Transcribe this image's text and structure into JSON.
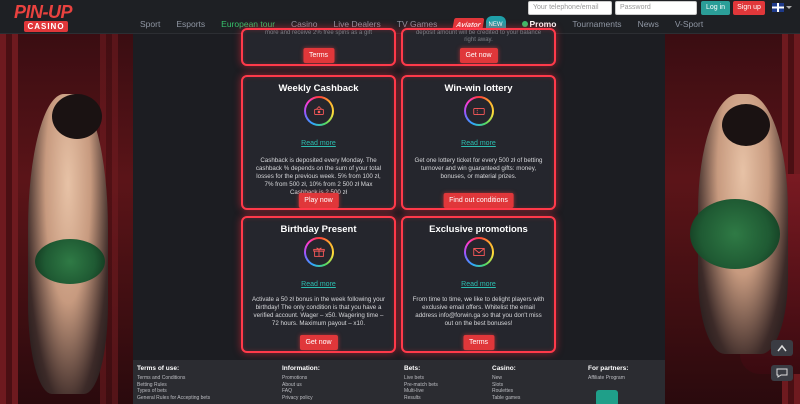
{
  "header": {
    "logo_top": "PIN-UP",
    "logo_bottom": "CASINO",
    "nav": [
      {
        "label": "Sport",
        "style": "normal"
      },
      {
        "label": "Esports",
        "style": "normal"
      },
      {
        "label": "European tour",
        "style": "active"
      },
      {
        "label": "Casino",
        "style": "normal"
      },
      {
        "label": "Live Dealers",
        "style": "normal"
      },
      {
        "label": "TV Games",
        "style": "normal"
      },
      {
        "label": "Aviator",
        "badge": "NEW",
        "style": "badge"
      },
      {
        "label": "Promo",
        "style": "highlight"
      },
      {
        "label": "Tournaments",
        "style": "normal"
      },
      {
        "label": "News",
        "style": "normal"
      },
      {
        "label": "V-Sport",
        "style": "normal"
      }
    ],
    "phone_placeholder": "Your telephone/email",
    "password_placeholder": "Password",
    "login_label": "Log in",
    "signup_label": "Sign up",
    "language_icon": "uk-flag-icon"
  },
  "cards": {
    "top_left": {
      "partial_text": "more and receive 2% free spins as a gift",
      "button": "Terms"
    },
    "top_right": {
      "partial_text": "deposit amount will be credited to your balance right away.",
      "button": "Get now"
    },
    "weekly_cashback": {
      "title": "Weekly Cashback",
      "icon": "cashback-icon",
      "link": "Read more",
      "desc": "Cashback is deposited every Monday. The cashback % depends on the sum of your total losses for the previous week. 5% from 100 zł, 7% from 500 zł, 10% from 2 500 zł Max Cashback is 2 500 zł",
      "button": "Play now"
    },
    "winwin_lottery": {
      "title": "Win-win lottery",
      "icon": "ticket-icon",
      "link": "Read more",
      "desc": "Get one lottery ticket for every 500 zł of betting turnover and win guaranteed gifts: money, bonuses, or material prizes.",
      "button": "Find out conditions"
    },
    "birthday_present": {
      "title": "Birthday Present",
      "icon": "gift-icon",
      "link": "Read more",
      "desc": "Activate a 50 zł bonus in the week following your birthday! The only condition is that you have a verified account. Wager – x50. Wagering time – 72 hours. Maximum payout – x10.",
      "button": "Get now"
    },
    "exclusive_promotions": {
      "title": "Exclusive promotions",
      "icon": "envelope-icon",
      "link": "Read more",
      "desc": "From time to time, we like to delight players with exclusive email offers. Whitelist the email address info@forwin.ga so that you don't miss out on the best bonuses!",
      "button": "Terms"
    }
  },
  "footer": {
    "terms": {
      "title": "Terms of use:",
      "items": [
        "Terms and Conditions",
        "Betting Rules",
        "Types of bets",
        "General Rules for Accepting bets"
      ]
    },
    "information": {
      "title": "Information:",
      "items": [
        "Promotions",
        "About us",
        "FAQ",
        "Privacy policy"
      ]
    },
    "bets": {
      "title": "Bets:",
      "items": [
        "Live bets",
        "Pre-match bets",
        "Multi-live",
        "Results"
      ]
    },
    "casino": {
      "title": "Casino:",
      "items": [
        "New",
        "Slots",
        "Roulettes",
        "Table games"
      ]
    },
    "partners": {
      "title": "For partners:",
      "items": [
        "Affiliate Program"
      ]
    }
  },
  "floating": {
    "up_icon": "chevron-up-icon",
    "chat_icon": "chat-icon"
  }
}
